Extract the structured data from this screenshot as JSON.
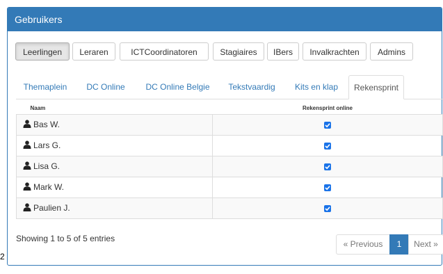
{
  "panel": {
    "title": "Gebruikers"
  },
  "role_buttons": [
    "Leerlingen",
    "Leraren",
    "ICTCoordinatoren",
    "Stagiaires",
    "IBers",
    "Invalkrachten",
    "Admins"
  ],
  "active_role": "Leerlingen",
  "tabs": [
    "Themaplein",
    "DC Online",
    "DC Online Belgie",
    "Tekstvaardig",
    "Kits en klap",
    "Rekensprint"
  ],
  "active_tab": "Rekensprint",
  "table": {
    "headers": [
      "Naam",
      "Rekensprint online"
    ],
    "rows": [
      {
        "name": "Bas W.",
        "checked": true
      },
      {
        "name": "Lars G.",
        "checked": true
      },
      {
        "name": "Lisa G.",
        "checked": true
      },
      {
        "name": "Mark W.",
        "checked": true
      },
      {
        "name": "Paulien J.",
        "checked": true
      }
    ]
  },
  "footer": {
    "info": "Showing 1 to 5 of 5 entries",
    "previous": "« Previous",
    "page": "1",
    "next": "Next »"
  },
  "stray_char": "2",
  "colors": {
    "primary": "#337ab7",
    "checkbox": "#1a73e8"
  },
  "icons": {
    "user": "user-icon",
    "check": "check-icon"
  }
}
